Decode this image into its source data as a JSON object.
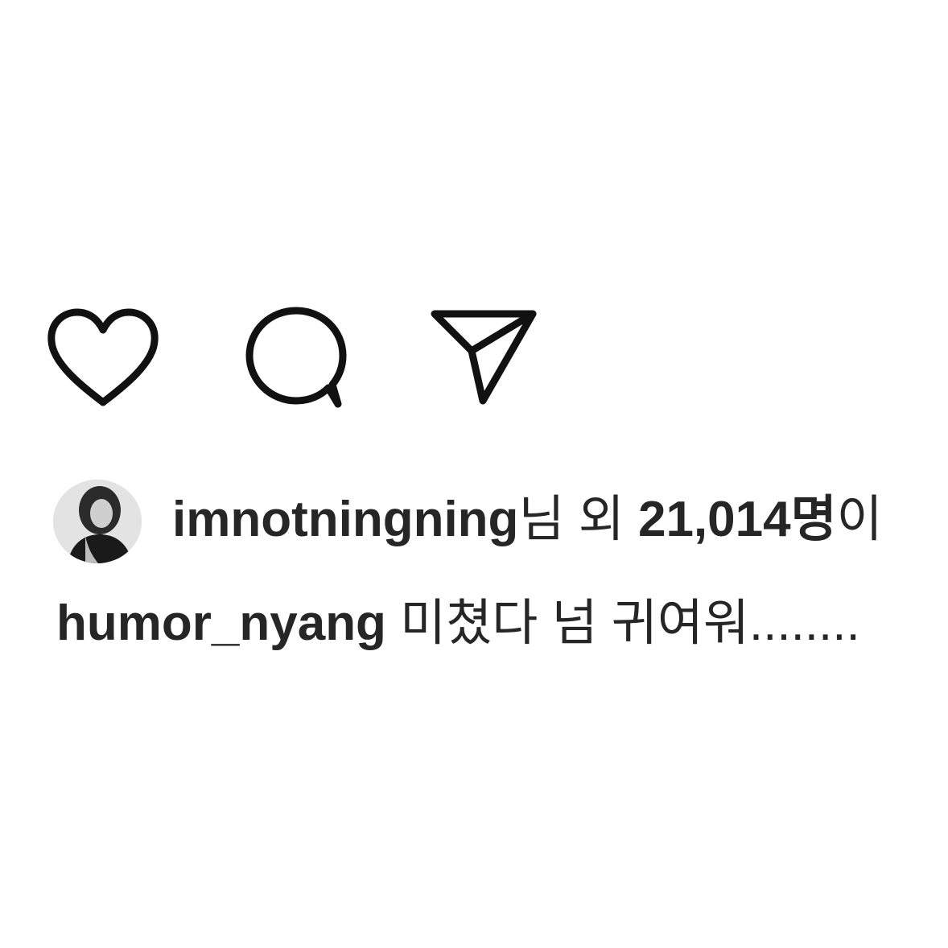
{
  "post": {
    "actions": {
      "like_icon": "heart-outline-icon",
      "comment_icon": "speech-bubble-icon",
      "share_icon": "paper-plane-icon"
    },
    "likes": {
      "first_liker": "imnotningning",
      "suffix_1": "님 외 ",
      "count": "21,014명",
      "suffix_2": "이"
    },
    "caption": {
      "username": "humor_nyang",
      "text": " 미쳤다 넘 귀여워........"
    }
  },
  "colors": {
    "text": "#262626",
    "icon": "#111111",
    "background": "#ffffff"
  }
}
